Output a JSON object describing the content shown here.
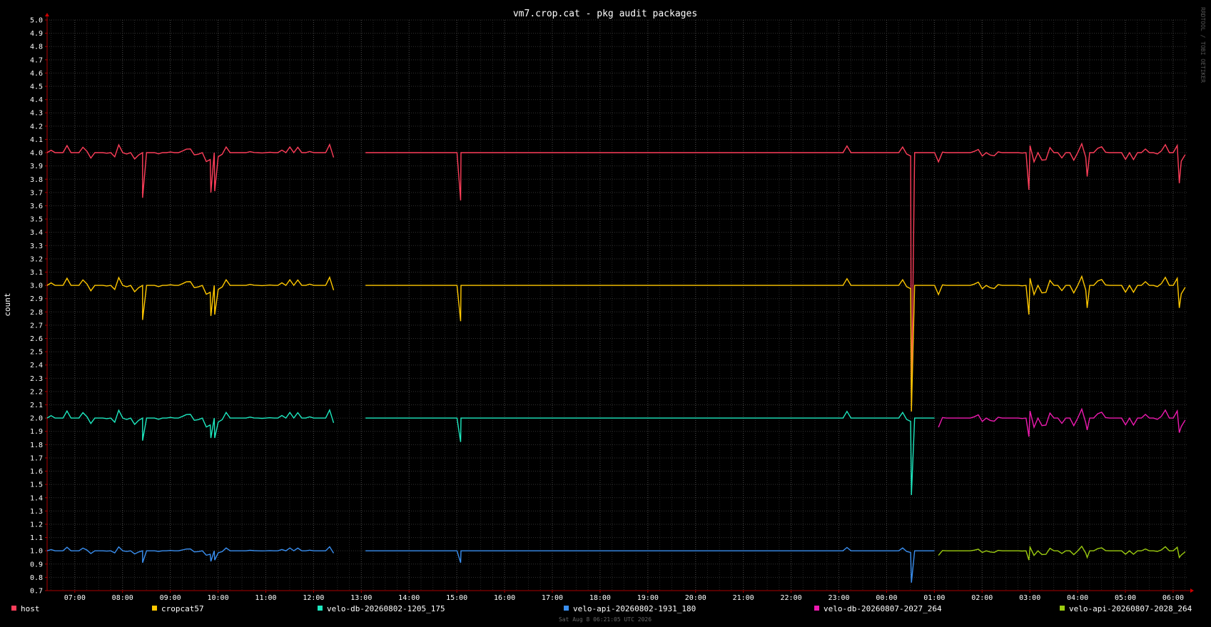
{
  "chart_data": {
    "type": "line",
    "title": "vm7.crop.cat - pkg audit packages",
    "ylabel": "count",
    "xlabel": "",
    "ylim": [
      0.7,
      5.0
    ],
    "y_ticks": [
      "5.0",
      "4.9",
      "4.8",
      "4.7",
      "4.6",
      "4.5",
      "4.4",
      "4.3",
      "4.2",
      "4.1",
      "4.0",
      "3.9",
      "3.8",
      "3.7",
      "3.6",
      "3.5",
      "3.4",
      "3.3",
      "3.2",
      "3.1",
      "3.0",
      "2.9",
      "2.8",
      "2.7",
      "2.6",
      "2.5",
      "2.4",
      "2.3",
      "2.2",
      "2.1",
      "2.0",
      "1.9",
      "1.8",
      "1.7",
      "1.6",
      "1.5",
      "1.4",
      "1.3",
      "1.2",
      "1.1",
      "1.0",
      "0.9",
      "0.8",
      "0.7"
    ],
    "x_range_hours": [
      6.42,
      30.3
    ],
    "x_ticks": [
      {
        "label": "07:00",
        "h": 7
      },
      {
        "label": "08:00",
        "h": 8
      },
      {
        "label": "09:00",
        "h": 9
      },
      {
        "label": "10:00",
        "h": 10
      },
      {
        "label": "11:00",
        "h": 11
      },
      {
        "label": "12:00",
        "h": 12
      },
      {
        "label": "13:00",
        "h": 13
      },
      {
        "label": "14:00",
        "h": 14
      },
      {
        "label": "15:00",
        "h": 15
      },
      {
        "label": "16:00",
        "h": 16
      },
      {
        "label": "17:00",
        "h": 17
      },
      {
        "label": "18:00",
        "h": 18
      },
      {
        "label": "19:00",
        "h": 19
      },
      {
        "label": "20:00",
        "h": 20
      },
      {
        "label": "21:00",
        "h": 21
      },
      {
        "label": "22:00",
        "h": 22
      },
      {
        "label": "23:00",
        "h": 23
      },
      {
        "label": "00:00",
        "h": 24
      },
      {
        "label": "01:00",
        "h": 25
      },
      {
        "label": "02:00",
        "h": 26
      },
      {
        "label": "03:00",
        "h": 27
      },
      {
        "label": "04:00",
        "h": 28
      },
      {
        "label": "05:00",
        "h": 29
      },
      {
        "label": "06:00",
        "h": 30
      }
    ],
    "gap_hours": [
      12.45,
      13.02
    ],
    "series": [
      {
        "name": "host",
        "color": "#ff3e5a",
        "base": 4.0,
        "start": 6.42,
        "end": 30.3,
        "dips": [
          [
            8.42,
            3.66
          ],
          [
            9.85,
            3.7
          ],
          [
            9.93,
            3.71
          ],
          [
            15.08,
            3.64
          ],
          [
            24.52,
            2.05
          ],
          [
            26.98,
            3.72
          ],
          [
            28.2,
            3.82
          ],
          [
            30.13,
            3.77
          ]
        ]
      },
      {
        "name": "cropcat57",
        "color": "#ffc800",
        "base": 3.0,
        "start": 6.42,
        "end": 30.3,
        "dips": [
          [
            8.42,
            2.74
          ],
          [
            9.85,
            2.77
          ],
          [
            9.93,
            2.78
          ],
          [
            15.08,
            2.73
          ],
          [
            24.52,
            2.05
          ],
          [
            26.98,
            2.78
          ],
          [
            28.2,
            2.83
          ],
          [
            30.13,
            2.83
          ]
        ]
      },
      {
        "name": "velo-db-20260802-1205_175",
        "color": "#1de9c0",
        "base": 2.0,
        "start": 6.42,
        "end": 25.05,
        "dips": [
          [
            8.42,
            1.83
          ],
          [
            9.85,
            1.85
          ],
          [
            9.93,
            1.85
          ],
          [
            15.08,
            1.82
          ],
          [
            24.52,
            1.42
          ]
        ]
      },
      {
        "name": "velo-api-20260802-1931_180",
        "color": "#3a8ff0",
        "base": 1.0,
        "start": 6.42,
        "end": 25.05,
        "dips": [
          [
            8.42,
            0.91
          ],
          [
            9.85,
            0.92
          ],
          [
            9.93,
            0.93
          ],
          [
            15.08,
            0.91
          ],
          [
            24.52,
            0.76
          ]
        ]
      },
      {
        "name": "velo-db-20260807-2027_264",
        "color": "#ee1ab0",
        "base": 2.0,
        "start": 25.05,
        "end": 30.3,
        "dips": [
          [
            26.98,
            1.86
          ],
          [
            28.2,
            1.91
          ],
          [
            30.13,
            1.89
          ]
        ]
      },
      {
        "name": "velo-api-20260807-2028_264",
        "color": "#9ccc10",
        "base": 1.0,
        "start": 25.05,
        "end": 30.3,
        "dips": [
          [
            26.98,
            0.93
          ],
          [
            28.2,
            0.95
          ],
          [
            30.13,
            0.95
          ]
        ]
      }
    ]
  },
  "watermark": "RRDTOOL / TOBI OETIKER",
  "footer": "Sat Aug  8 06:21:05 UTC 2026"
}
